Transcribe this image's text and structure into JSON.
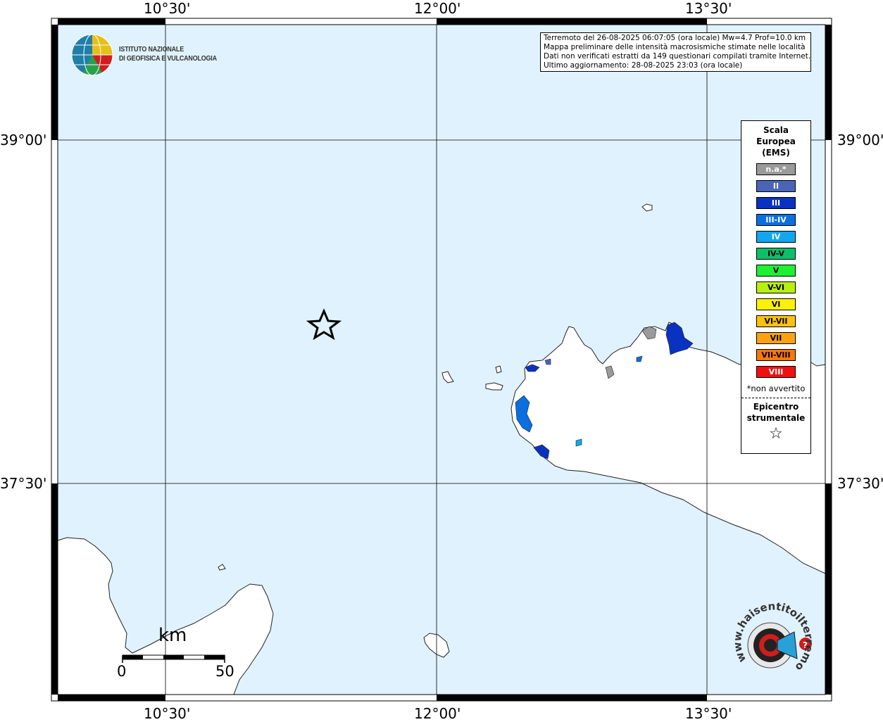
{
  "map": {
    "longitude_ticks": [
      "10°30'",
      "12°00'",
      "13°30'"
    ],
    "latitude_ticks": [
      "39°00'",
      "37°30'"
    ],
    "epicenter_icon": "star-outline-icon",
    "colors": {
      "sea": "#e0f2fd",
      "land": "#ffffff"
    }
  },
  "logo": {
    "line1": "ISTITUTO NAZIONALE",
    "line2": "DI GEOFISICA E VULCANOLOGIA"
  },
  "info": {
    "line1": "Terremoto del 26-08-2025 06:07:05 (ora locale) Mw=4.7 Prof=10.0 km",
    "line2": "Mappa preliminare delle intensità macrosismiche stimate nelle località",
    "line3": "Dati non verificati estratti da 149 questionari compilati tramite Internet.",
    "line4": "Ultimo aggiornamento: 28-08-2025 23:03 (ora locale)"
  },
  "legend": {
    "title_1": "Scala",
    "title_2": "Europea",
    "title_3": "(EMS)",
    "items": [
      {
        "label": "n.a.*",
        "color": "#9a9a9a"
      },
      {
        "label": "II",
        "color": "#4a65b8"
      },
      {
        "label": "III",
        "color": "#0a32c0"
      },
      {
        "label": "III-IV",
        "color": "#0a6fe0"
      },
      {
        "label": "IV",
        "color": "#11a7ee"
      },
      {
        "label": "IV-V",
        "color": "#0cc06a"
      },
      {
        "label": "V",
        "color": "#1ef032"
      },
      {
        "label": "V-VI",
        "color": "#b6f010"
      },
      {
        "label": "VI",
        "color": "#fcf10a"
      },
      {
        "label": "VI-VII",
        "color": "#fcc10c"
      },
      {
        "label": "VII",
        "color": "#fca214"
      },
      {
        "label": "VII-VIII",
        "color": "#f8780a"
      },
      {
        "label": "VIII",
        "color": "#f01010"
      }
    ],
    "note": "*non avvertito",
    "epicenter_1": "Epicentro",
    "epicenter_2": "strumentale",
    "epicenter_symbol": "☆"
  },
  "scalebar": {
    "unit": "km",
    "min": "0",
    "max": "50"
  },
  "watermark": {
    "text": "www.haisentitoilterremoto.it",
    "icon": "megaphone-icon"
  }
}
